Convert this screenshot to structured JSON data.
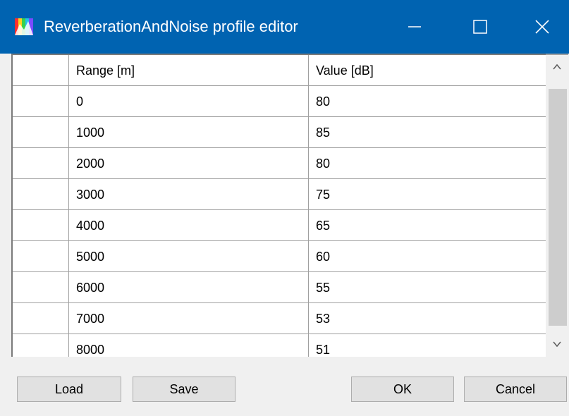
{
  "window": {
    "title": "ReverberationAndNoise profile editor",
    "title_bar_color": "#0063b1"
  },
  "title_buttons": {
    "minimize_icon": "minimize-icon",
    "maximize_icon": "maximize-icon",
    "close_icon": "close-icon"
  },
  "grid": {
    "columns": [
      "Range [m]",
      "Value [dB]"
    ],
    "rows": [
      {
        "range": "0",
        "value": "80"
      },
      {
        "range": "1000",
        "value": "85"
      },
      {
        "range": "2000",
        "value": "80"
      },
      {
        "range": "3000",
        "value": "75"
      },
      {
        "range": "4000",
        "value": "65"
      },
      {
        "range": "5000",
        "value": "60"
      },
      {
        "range": "6000",
        "value": "55"
      },
      {
        "range": "7000",
        "value": "53"
      },
      {
        "range": "8000",
        "value": "51"
      }
    ]
  },
  "buttons": {
    "load": "Load",
    "save": "Save",
    "ok": "OK",
    "cancel": "Cancel"
  }
}
